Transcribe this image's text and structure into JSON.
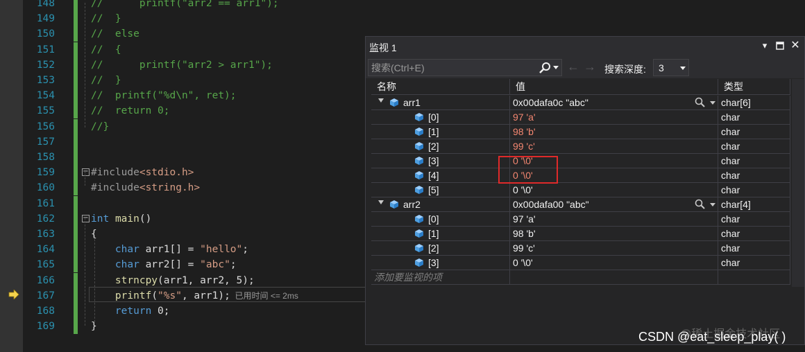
{
  "editor": {
    "lines": [
      {
        "num": "148",
        "text": "//      printf(\"arr2 == arr1\");"
      },
      {
        "num": "149",
        "text": "//  }"
      },
      {
        "num": "150",
        "text": "//  else"
      },
      {
        "num": "151",
        "text": "//  {"
      },
      {
        "num": "152",
        "text": "//      printf(\"arr2 > arr1\");"
      },
      {
        "num": "153",
        "text": "//  }"
      },
      {
        "num": "154",
        "text": "//  printf(\"%d\\n\", ret);"
      },
      {
        "num": "155",
        "text": "//  return 0;"
      },
      {
        "num": "156",
        "text": "//}"
      },
      {
        "num": "157",
        "text": ""
      },
      {
        "num": "158",
        "text": ""
      },
      {
        "num": "159",
        "text": "#include<stdio.h>"
      },
      {
        "num": "160",
        "text": "#include<string.h>"
      },
      {
        "num": "161",
        "text": ""
      },
      {
        "num": "162",
        "text": "int main()"
      },
      {
        "num": "163",
        "text": "{"
      },
      {
        "num": "164",
        "text": "    char arr1[] = \"hello\";"
      },
      {
        "num": "165",
        "text": "    char arr2[] = \"abc\";"
      },
      {
        "num": "166",
        "text": "    strncpy(arr1, arr2, 5);"
      },
      {
        "num": "167",
        "text": "    printf(\"%s\", arr1);"
      },
      {
        "num": "168",
        "text": "    return 0;"
      },
      {
        "num": "169",
        "text": "}"
      }
    ],
    "perf_tip": "已用时间 <= 2ms"
  },
  "watch": {
    "title": "监视 1",
    "search_placeholder": "搜索(Ctrl+E)",
    "depth_label": "搜索深度:",
    "depth_value": "3",
    "columns": {
      "name": "名称",
      "value": "值",
      "type": "类型"
    },
    "rows": [
      {
        "name": "arr1",
        "value": "0x00dafa0c \"abc\"",
        "type": "char[6]",
        "level": 0,
        "changed": false
      },
      {
        "name": "[0]",
        "value": "97 'a'",
        "type": "char",
        "level": 1,
        "changed": true
      },
      {
        "name": "[1]",
        "value": "98 'b'",
        "type": "char",
        "level": 1,
        "changed": true
      },
      {
        "name": "[2]",
        "value": "99 'c'",
        "type": "char",
        "level": 1,
        "changed": true
      },
      {
        "name": "[3]",
        "value": "0 '\\0'",
        "type": "char",
        "level": 1,
        "changed": true
      },
      {
        "name": "[4]",
        "value": "0 '\\0'",
        "type": "char",
        "level": 1,
        "changed": true
      },
      {
        "name": "[5]",
        "value": "0 '\\0'",
        "type": "char",
        "level": 1,
        "changed": false
      },
      {
        "name": "arr2",
        "value": "0x00dafa00 \"abc\"",
        "type": "char[4]",
        "level": 0,
        "changed": false
      },
      {
        "name": "[0]",
        "value": "97 'a'",
        "type": "char",
        "level": 1,
        "changed": false
      },
      {
        "name": "[1]",
        "value": "98 'b'",
        "type": "char",
        "level": 1,
        "changed": false
      },
      {
        "name": "[2]",
        "value": "99 'c'",
        "type": "char",
        "level": 1,
        "changed": false
      },
      {
        "name": "[3]",
        "value": "0 '\\0'",
        "type": "char",
        "level": 1,
        "changed": false
      }
    ],
    "add_watch_placeholder": "添加要监视的项"
  },
  "watermark": {
    "text": "CSDN @eat_sleep_play( )",
    "faint_text": "@稀土掘金技术社区"
  },
  "colors": {
    "changed_value": "#f48771",
    "comment": "#57a64a",
    "keyword": "#569cd6",
    "string": "#d69d85",
    "line_number": "#2b91af",
    "highlight_box": "#e02a2a"
  },
  "icons": [
    "execution-arrow-icon",
    "collapse-icon",
    "search-icon",
    "back-arrow-icon",
    "forward-arrow-icon",
    "variable-icon",
    "magnifier-icon",
    "pin-icon",
    "maximize-icon",
    "close-icon",
    "window-menu-icon"
  ]
}
